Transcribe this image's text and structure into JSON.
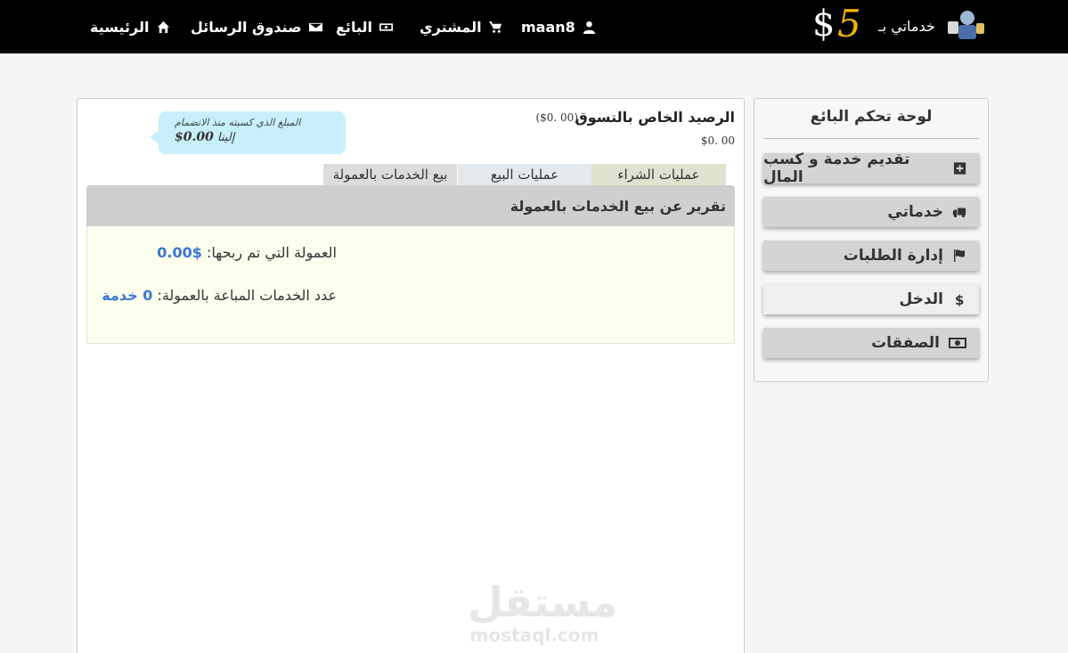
{
  "header": {
    "logo": {
      "dollar": "$",
      "number": "5",
      "text": "خدماتي بـ"
    },
    "nav": [
      {
        "label": "الرئيسية",
        "icon": "home-icon"
      },
      {
        "label": "صندوق الرسائل",
        "icon": "envelope-icon"
      },
      {
        "label": "البائع",
        "icon": "money-icon"
      },
      {
        "label": "المشتري",
        "icon": "cart-icon"
      },
      {
        "label": "maan8",
        "icon": "user-icon"
      }
    ]
  },
  "sidebar": {
    "title": "لوحة تحكم البائع",
    "items": [
      {
        "label": "تقديم خدمة و كسب المال",
        "icon": "plus-square-icon"
      },
      {
        "label": "خدماتي",
        "icon": "truck-icon"
      },
      {
        "label": "إدارة الطلبات",
        "icon": "flag-icon"
      },
      {
        "label": "الدخل",
        "icon": "dollar-icon",
        "active": true
      },
      {
        "label": "الصفقات",
        "icon": "cash-icon"
      }
    ]
  },
  "balance": {
    "title": "الرصيد الخاص بالتسوق",
    "sub": "($0. 00)",
    "value": "$0. 00"
  },
  "bubble": {
    "line1": "المبلغ الذي كسبته منذ الانضمام",
    "line2_prefix": "إلينا",
    "line2_amount": "$0.00"
  },
  "tabs": [
    "عمليات الشراء",
    "عمليات البيع",
    "بيع الخدمات بالعمولة"
  ],
  "report": {
    "title": "تقرير عن بيع الخدمات بالعمولة",
    "commission_label": "العمولة التي تم ربحها:",
    "commission_value": "$0.00",
    "count_label": "عدد الخدمات المباعة بالعمولة:",
    "count_value": "0 خدمة"
  },
  "watermark": {
    "arabic": "مستقل",
    "latin": "mostaql.com"
  },
  "colors": {
    "topbar": "#000000",
    "accent_blue": "#3a78d4",
    "bubble": "#c8f0fa",
    "report_body": "#fbfded"
  }
}
